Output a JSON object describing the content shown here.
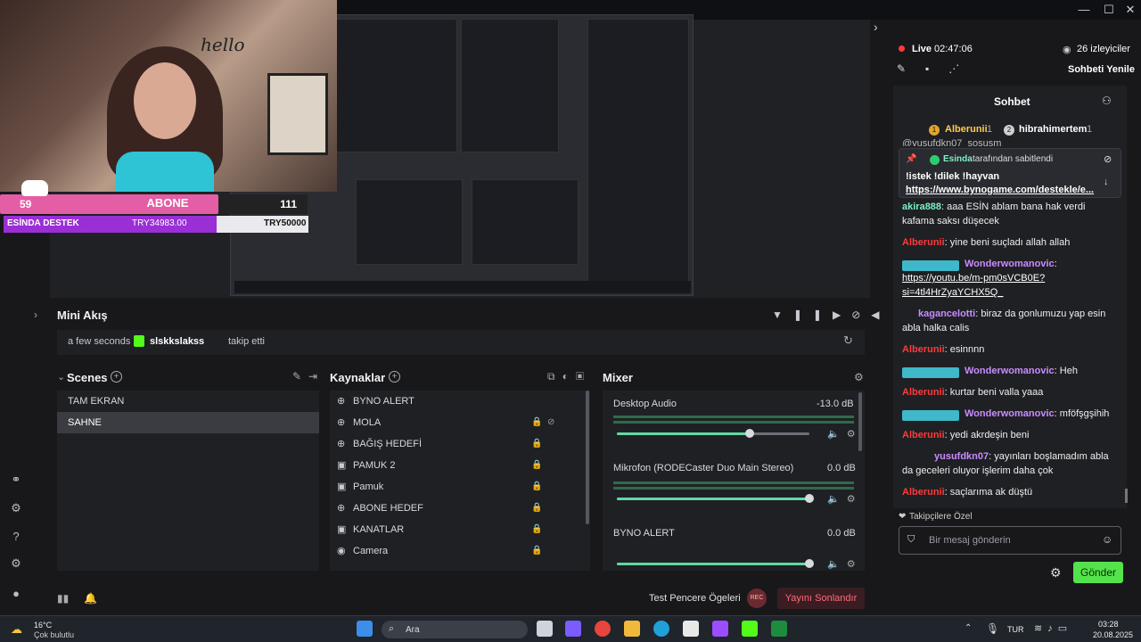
{
  "window": {
    "minimize": "—",
    "maximize": "☐",
    "close": "✕"
  },
  "overlay": {
    "hello_text": "hello",
    "sub_count": "59",
    "sub_label": "ABONE",
    "sub_target": "111",
    "donation_label": "ESİNDA DESTEK",
    "donation_current": "TRY34983.00",
    "donation_target": "TRY50000",
    "donation_progress": 0.6997
  },
  "mini_akis": {
    "title": "Mini Akış",
    "event_time": "a few seconds",
    "event_user": "slskkslakss",
    "event_action": "takip etti"
  },
  "scenes": {
    "title": "Scenes",
    "items": [
      {
        "label": "TAM EKRAN",
        "selected": false
      },
      {
        "label": "SAHNE",
        "selected": true
      }
    ]
  },
  "sources": {
    "title": "Kaynaklar",
    "items": [
      {
        "label": "BYNO ALERT",
        "icon": "globe-icon"
      },
      {
        "label": "MOLA",
        "icon": "globe-icon"
      },
      {
        "label": "BAĞIŞ HEDEFİ",
        "icon": "globe-icon"
      },
      {
        "label": "PAMUK 2",
        "icon": "image-icon"
      },
      {
        "label": "Pamuk",
        "icon": "image-icon"
      },
      {
        "label": "ABONE HEDEF",
        "icon": "globe-icon"
      },
      {
        "label": "KANATLAR",
        "icon": "image-icon"
      },
      {
        "label": "Camera",
        "icon": "camera-icon"
      }
    ]
  },
  "mixer": {
    "title": "Mixer",
    "channels": [
      {
        "name": "Desktop Audio",
        "db": "-13.0 dB",
        "level": 0.69
      },
      {
        "name": "Mikrofon (RODECaster Duo Main Stereo)",
        "db": "0.0 dB",
        "level": 1.0
      },
      {
        "name": "BYNO ALERT",
        "db": "0.0 dB",
        "level": 1.0
      }
    ]
  },
  "bottom": {
    "test_label": "Test Pencere Ögeleri",
    "rec_label": "REC",
    "end_label": "Yayını Sonlandır"
  },
  "stream": {
    "live_label": "Live",
    "live_time": "02:47:06",
    "viewers": "26 izleyiciler",
    "refresh_chat": "Sohbeti Yenile"
  },
  "chat": {
    "title": "Sohbet",
    "top_users": [
      {
        "rank": "1",
        "name": "Alberunii",
        "count": "1"
      },
      {
        "rank": "2",
        "name": "hibrahimertem",
        "count": "1"
      }
    ],
    "partial_top": "@yusufdkn07_sosusm",
    "pinned_by": "Esinda",
    "pinned_suffix": "tarafından sabitlendi",
    "pinned_text": "!istek !dilek !hayvan",
    "pinned_link": "https://www.bynogame.com/destekle/e...",
    "messages": [
      {
        "user": "akira888",
        "color": "#7df0c6",
        "text": "aaa ESİN ablam bana hak verdi kafama saksı düşecek"
      },
      {
        "user": "Alberunii",
        "color": "#ff3b3b",
        "text": "yine beni suçladı allah allah"
      },
      {
        "user": "Wonderwomanovic",
        "color": "#c98cff",
        "text": "",
        "link": "https://youtu.be/m-pm0sVCB0E?si=4tl4HrZyaYCHX5Q_"
      },
      {
        "user": "kagancelotti",
        "color": "#c98cff",
        "text": "biraz da gonlumuzu yap esin abla halka calis"
      },
      {
        "user": "Alberunii",
        "color": "#ff3b3b",
        "text": "esinnnn"
      },
      {
        "user": "Wonderwomanovic",
        "color": "#c98cff",
        "text": "Heh"
      },
      {
        "user": "Alberunii",
        "color": "#ff3b3b",
        "text": "kurtar beni valla yaaa"
      },
      {
        "user": "Wonderwomanovic",
        "color": "#c98cff",
        "text": "mföfşgşihih"
      },
      {
        "user": "Alberunii",
        "color": "#ff3b3b",
        "text": "yedi akrdeşin beni"
      },
      {
        "user": "yusufdkn07",
        "color": "#c98cff",
        "text": "yayınları boşlamadım abla da geceleri oluyor işlerim daha çok"
      },
      {
        "user": "Alberunii",
        "color": "#ff3b3b",
        "text": "saçlarıma ak düştü"
      }
    ],
    "followers_only": "Takipçilere Özel",
    "input_placeholder": "Bir mesaj gönderin",
    "send_label": "Gönder"
  },
  "taskbar": {
    "weather_temp": "16°C",
    "weather_desc": "Çok bulutlu",
    "search_label": "Ara",
    "lang": "TUR",
    "time": "03:28",
    "date": "20.08.2025"
  }
}
